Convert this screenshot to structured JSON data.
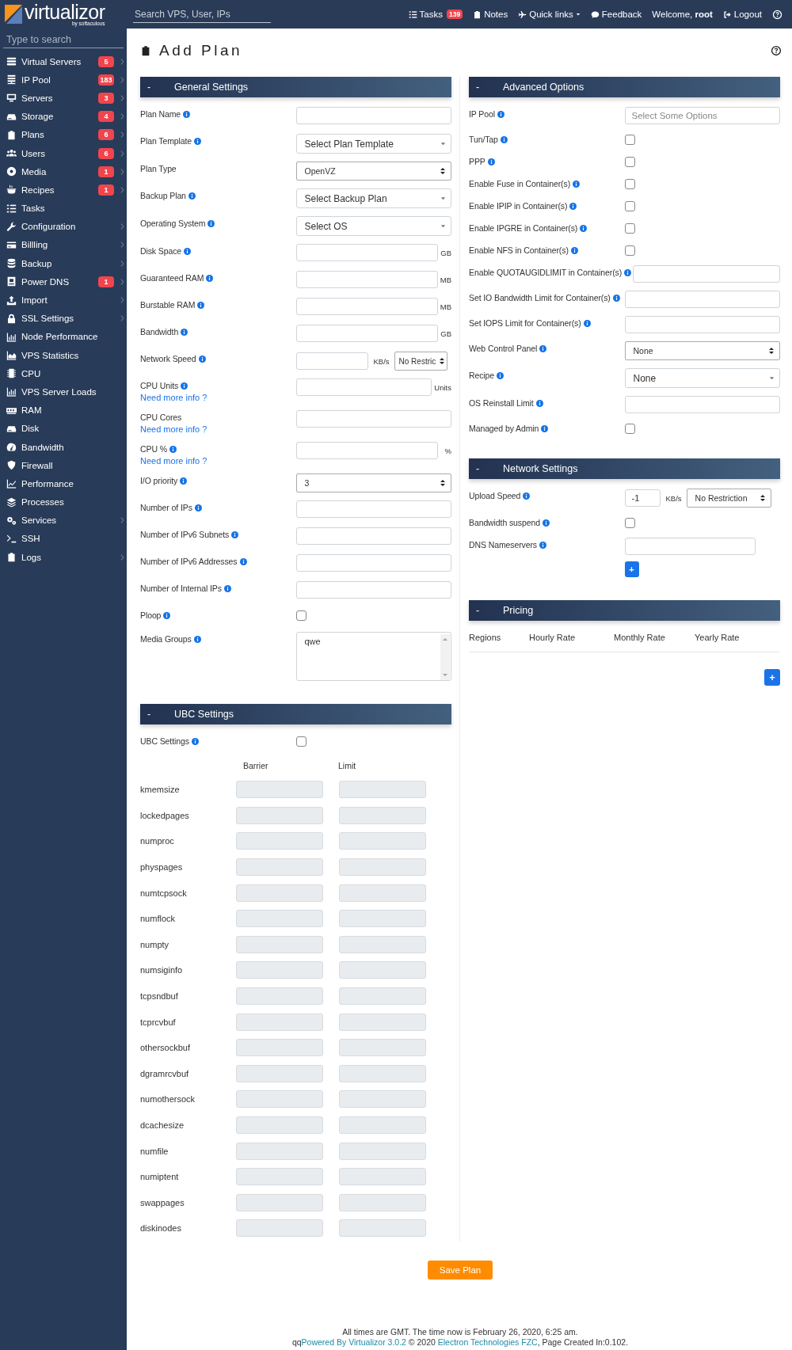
{
  "header": {
    "logo": "virtualizor",
    "logo_tagline": "by softaculous",
    "search_placeholder": "Search VPS, User, IPs",
    "nav": [
      {
        "label": "Tasks",
        "badge": "139"
      },
      {
        "label": "Notes"
      },
      {
        "label": "Quick links",
        "dropdown": true
      },
      {
        "label": "Feedback"
      },
      {
        "label": "Welcome, **root**",
        "kind": "welcome"
      },
      {
        "label": "Logout"
      }
    ]
  },
  "sidebar": {
    "search_placeholder": "Type to search",
    "items": [
      {
        "label": "Virtual Servers",
        "badge": "5",
        "expandable": true
      },
      {
        "label": "IP Pool",
        "badge": "183",
        "expandable": true
      },
      {
        "label": "Servers",
        "badge": "3",
        "expandable": true
      },
      {
        "label": "Storage",
        "badge": "4",
        "expandable": true
      },
      {
        "label": "Plans",
        "badge": "6",
        "expandable": true
      },
      {
        "label": "Users",
        "badge": "6",
        "expandable": true
      },
      {
        "label": "Media",
        "badge": "1",
        "expandable": true
      },
      {
        "label": "Recipes",
        "badge": "1",
        "expandable": true
      },
      {
        "label": "Tasks",
        "expandable": false
      },
      {
        "label": "Configuration",
        "expandable": true
      },
      {
        "label": "Billling",
        "expandable": true
      },
      {
        "label": "Backup",
        "expandable": true
      },
      {
        "label": "Power DNS",
        "badge": "1",
        "expandable": true
      },
      {
        "label": "Import",
        "expandable": true
      },
      {
        "label": "SSL Settings",
        "expandable": true
      },
      {
        "label": "Node Performance",
        "expandable": false
      },
      {
        "label": "VPS Statistics",
        "expandable": false
      },
      {
        "label": "CPU",
        "expandable": false
      },
      {
        "label": "VPS Server Loads",
        "expandable": false
      },
      {
        "label": "RAM",
        "expandable": false
      },
      {
        "label": "Disk",
        "expandable": false
      },
      {
        "label": "Bandwidth",
        "expandable": false
      },
      {
        "label": "Firewall",
        "expandable": false
      },
      {
        "label": "Performance",
        "expandable": false
      },
      {
        "label": "Processes",
        "expandable": false
      },
      {
        "label": "Services",
        "expandable": true
      },
      {
        "label": "SSH",
        "expandable": false
      },
      {
        "label": "Logs",
        "expandable": true
      }
    ]
  },
  "page": {
    "title": "Add Plan"
  },
  "left_column": [
    {
      "toggle": "-",
      "title": "General Settings",
      "fields": [
        {
          "label": "Plan Name",
          "info": true,
          "kind": "text"
        },
        {
          "label": "Plan Template",
          "info": true,
          "kind": "select",
          "value": "Select Plan Template"
        },
        {
          "label": "Plan Type",
          "info": false,
          "kind": "native",
          "value": "OpenVZ"
        },
        {
          "label": "Backup Plan",
          "info": true,
          "kind": "select",
          "value": "Select Backup Plan"
        },
        {
          "label": "Operating System",
          "info": true,
          "kind": "select",
          "value": "Select OS"
        },
        {
          "label": "Disk Space",
          "info": true,
          "kind": "unit",
          "unit": "GB"
        },
        {
          "label": "Guaranteed RAM",
          "info": true,
          "kind": "unit",
          "unit": "MB"
        },
        {
          "label": "Burstable RAM",
          "info": true,
          "kind": "unit",
          "unit": "MB"
        },
        {
          "label": "Bandwidth",
          "info": true,
          "kind": "unit",
          "unit": "GB"
        },
        {
          "label": "Network Speed",
          "info": true,
          "kind": "speed",
          "unit": "KB/s",
          "option": "No Restric"
        },
        {
          "label": "CPU Units",
          "info": true,
          "kind": "unit",
          "unit": "Units",
          "link": "Need more info ?"
        },
        {
          "label": "CPU Cores",
          "info": false,
          "kind": "text",
          "link": "Need more info ?"
        },
        {
          "label": "CPU %",
          "info": true,
          "kind": "unit",
          "unit": "%",
          "link": "Need more info ?"
        },
        {
          "label": "I/O priority",
          "info": true,
          "kind": "native",
          "value": "3"
        },
        {
          "label": "Number of IPs",
          "info": true,
          "kind": "text"
        },
        {
          "label": "Number of IPv6 Subnets",
          "info": true,
          "kind": "text"
        },
        {
          "label": "Number of IPv6 Addresses",
          "info": true,
          "kind": "text"
        },
        {
          "label": "Number of Internal IPs",
          "info": true,
          "kind": "text"
        },
        {
          "label": "Ploop",
          "info": true,
          "kind": "checkbox",
          "checked": false
        },
        {
          "label": "Media Groups",
          "info": true,
          "kind": "textarea",
          "value": "qwe"
        }
      ]
    },
    {
      "toggle": "-",
      "title": "UBC Settings",
      "fields": [
        {
          "label": "UBC Settings",
          "info": true,
          "kind": "checkbox",
          "checked": false
        }
      ],
      "ubc_table": {
        "columns": [
          "Barrier",
          "Limit"
        ],
        "disabled": true,
        "rows": [
          "kmemsize",
          "lockedpages",
          "numproc",
          "physpages",
          "numtcpsock",
          "numflock",
          "numpty",
          "numsiginfo",
          "tcpsndbuf",
          "tcprcvbuf",
          "othersockbuf",
          "dgramrcvbuf",
          "numothersock",
          "dcachesize",
          "numfile",
          "numiptent",
          "swappages",
          "diskinodes"
        ]
      }
    }
  ],
  "right_column": [
    {
      "toggle": "-",
      "title": "Advanced Options",
      "fields": [
        {
          "label": "IP Pool",
          "info": true,
          "kind": "multiselect",
          "placeholder": "Select Some Options"
        },
        {
          "label": "Tun/Tap",
          "info": true,
          "kind": "checkbox",
          "checked": false
        },
        {
          "label": "PPP",
          "info": true,
          "kind": "checkbox",
          "checked": false
        },
        {
          "label": "Enable Fuse in Container(s)",
          "info": true,
          "kind": "checkbox",
          "checked": false
        },
        {
          "label": "Enable IPIP in Container(s)",
          "info": true,
          "kind": "checkbox",
          "checked": false
        },
        {
          "label": "Enable IPGRE in Container(s)",
          "info": true,
          "kind": "checkbox",
          "checked": false
        },
        {
          "label": "Enable NFS in Container(s)",
          "info": true,
          "kind": "checkbox",
          "checked": false
        },
        {
          "label": "Enable QUOTAUGIDLIMIT in Container(s)",
          "info": true,
          "kind": "text"
        },
        {
          "label": "Set IO Bandwidth Limit for Container(s)",
          "info": true,
          "kind": "text"
        },
        {
          "label": "Set IOPS Limit for Container(s)",
          "info": true,
          "kind": "text"
        },
        {
          "label": "Web Control Panel",
          "info": true,
          "kind": "native",
          "value": "None"
        },
        {
          "label": "Recipe",
          "info": true,
          "kind": "select",
          "value": "None"
        },
        {
          "label": "OS Reinstall Limit",
          "info": true,
          "kind": "text"
        },
        {
          "label": "Managed by Admin",
          "info": true,
          "kind": "checkbox",
          "checked": false
        }
      ]
    },
    {
      "toggle": "-",
      "title": "Network Settings",
      "fields": [
        {
          "label": "Upload Speed",
          "info": true,
          "kind": "speed",
          "value": "-1",
          "unit": "KB/s",
          "option": "No Restriction"
        },
        {
          "label": "Bandwidth suspend",
          "info": true,
          "kind": "checkbox",
          "checked": false
        },
        {
          "label": "DNS Nameservers",
          "info": true,
          "kind": "dns",
          "add_button": "+"
        }
      ]
    },
    {
      "toggle": "-",
      "title": "Pricing",
      "pricing_table": {
        "columns": [
          "Regions",
          "Hourly Rate",
          "Monthly Rate",
          "Yearly Rate"
        ]
      },
      "add_button": "+"
    }
  ],
  "save_button": "Save Plan",
  "footer": {
    "line1": "All times are GMT. The time now is February 26, 2020, 6:25 am.",
    "line2": [
      {
        "text": "qq"
      },
      {
        "link": "Powered By Virtualizor 3.0.2"
      },
      {
        "text": " © 2020 "
      },
      {
        "link": "Electron Technologies FZC"
      },
      {
        "text": ", Page Created In:0.102."
      }
    ]
  }
}
